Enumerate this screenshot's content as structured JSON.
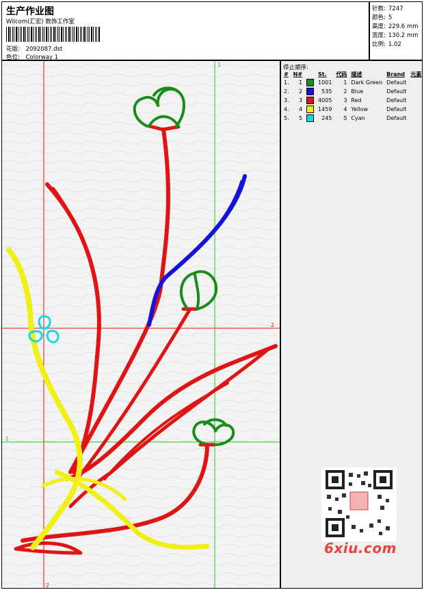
{
  "header": {
    "title": "生产作业图",
    "company": "Wilcom(汇宏) 数饰工作室",
    "design_label": "花版:",
    "design_value": "2092087.dst",
    "color_label": "色位:",
    "color_value": "Colorway 1"
  },
  "stats": [
    {
      "label": "针数:",
      "value": "7247"
    },
    {
      "label": "颜色:",
      "value": "5"
    },
    {
      "label": "高度:",
      "value": "229.6 mm"
    },
    {
      "label": "宽度:",
      "value": "130.2 mm"
    },
    {
      "label": "比例:",
      "value": "1.02"
    }
  ],
  "thread_panel": {
    "title": "停止顺序:",
    "columns": [
      "#",
      "N#",
      "St.",
      "代码",
      "描述",
      "Brand",
      "元素"
    ],
    "rows": [
      {
        "idx": "1.",
        "n": "1",
        "color": "#1a8c1a",
        "st": "1001",
        "code": "1",
        "desc": "Dark Green",
        "brand": "Default"
      },
      {
        "idx": "2.",
        "n": "2",
        "color": "#1414d8",
        "st": "535",
        "code": "2",
        "desc": "Blue",
        "brand": "Default"
      },
      {
        "idx": "3.",
        "n": "3",
        "color": "#e01414",
        "st": "4005",
        "code": "3",
        "desc": "Red",
        "brand": "Default"
      },
      {
        "idx": "4.",
        "n": "4",
        "color": "#f0f014",
        "st": "1459",
        "code": "4",
        "desc": "Yellow",
        "brand": "Default"
      },
      {
        "idx": "5.",
        "n": "5",
        "color": "#14d8e0",
        "st": "245",
        "code": "5",
        "desc": "Cyan",
        "brand": "Default"
      }
    ]
  },
  "guides": {
    "v1_label": "1",
    "h2_label": "2",
    "h1_label": "1",
    "v2_label": "2"
  },
  "watermark": {
    "brand": "6xiu.com"
  },
  "colors": {
    "red": "#e01414",
    "green": "#1a8c1a",
    "blue": "#1414d8",
    "yellow": "#f0f014",
    "cyan": "#14d8e0",
    "guide_red": "#e01414",
    "guide_green": "#22c422"
  }
}
